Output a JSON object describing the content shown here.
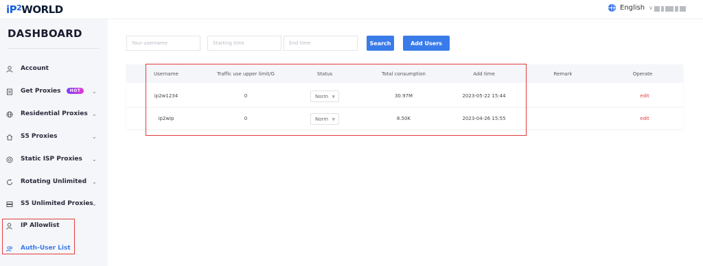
{
  "header": {
    "logo": {
      "part1": "iP",
      "part2": "2",
      "part3": "WORLD"
    },
    "language": "English"
  },
  "sidebar": {
    "title": "DASHBOARD",
    "items": [
      {
        "label": "Account",
        "icon": "user-icon",
        "has_arrow": false,
        "active": false
      },
      {
        "label": "Get Proxies",
        "icon": "document-icon",
        "badge": "HOT",
        "has_arrow": true,
        "active": false
      },
      {
        "label": "Residential Proxies",
        "icon": "globe-icon",
        "has_arrow": true,
        "active": false
      },
      {
        "label": "S5 Proxies",
        "icon": "home-icon",
        "has_arrow": true,
        "active": false
      },
      {
        "label": "Static ISP Proxies",
        "icon": "isp-icon",
        "has_arrow": true,
        "active": false
      },
      {
        "label": "Rotating Unlimited",
        "icon": "rotate-icon",
        "has_arrow": true,
        "active": false
      },
      {
        "label": "S5 Unlimited Proxies",
        "icon": "server-icon",
        "has_arrow": true,
        "active": false
      },
      {
        "label": "IP Allowlist",
        "icon": "user-check-icon",
        "has_arrow": false,
        "active": false
      },
      {
        "label": "Auth-User List",
        "icon": "users-icon",
        "has_arrow": false,
        "active": true
      }
    ],
    "arrow_glyph": "⌄"
  },
  "filters": {
    "username_placeholder": "Your username",
    "start_placeholder": "Starting time",
    "end_placeholder": "End time",
    "search_label": "Search",
    "add_users_label": "Add Users"
  },
  "table": {
    "columns": [
      "Username",
      "Traffic use upper limit/G",
      "Status",
      "Total consumption",
      "Add time",
      "Remark",
      "Operate"
    ],
    "rows": [
      {
        "username": "ip2w1234",
        "limit": "0",
        "status": "Norm",
        "consumption": "30.97M",
        "add_time": "2023-05-22 15:44",
        "remark": "",
        "operate": "edit"
      },
      {
        "username": "ip2wip",
        "limit": "0",
        "status": "Norm",
        "consumption": "8.50K",
        "add_time": "2023-04-26 15:55",
        "remark": "",
        "operate": "edit"
      }
    ]
  },
  "colors": {
    "accent": "#3a7bea",
    "highlight_border": "#e23a3a",
    "edit_link": "#e23a3a"
  }
}
